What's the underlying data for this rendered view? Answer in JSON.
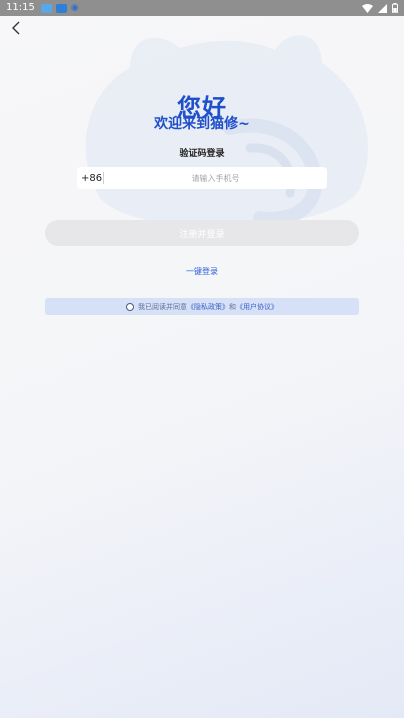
{
  "status_bar": {
    "time": "11:15",
    "icons": [
      "notification-app-icon",
      "notification-app-icon",
      "eye-icon",
      "wifi-icon",
      "signal-icon",
      "battery-icon"
    ]
  },
  "header": {
    "back_icon": "chevron-left-icon"
  },
  "greeting": {
    "title": "您好",
    "subtitle": "欢迎来到猫修~"
  },
  "login": {
    "type_label": "验证码登录",
    "country_code": "+86",
    "phone_placeholder": "请输入手机号",
    "submit_label": "注册并登录",
    "one_click_label": "一键登录"
  },
  "agreement": {
    "prefix": "我已阅读并同意",
    "privacy": "《隐私政策》",
    "and": "和",
    "user_agreement": "《用户协议》"
  },
  "colors": {
    "accent": "#1f4fc9",
    "link": "#2c5fd9",
    "agree_bg": "#d6e0f7",
    "button_disabled": "#e7e7ea"
  }
}
